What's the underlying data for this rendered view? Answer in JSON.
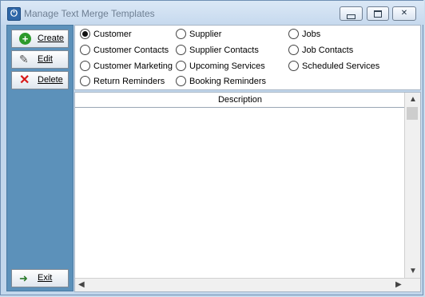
{
  "window": {
    "title": "Manage Text Merge Templates"
  },
  "sidebar": {
    "create": "Create",
    "edit": "Edit",
    "delete": "Delete",
    "exit": "Exit"
  },
  "radios": [
    {
      "label": "Customer",
      "selected": true
    },
    {
      "label": "Supplier",
      "selected": false
    },
    {
      "label": "Jobs",
      "selected": false
    },
    {
      "label": "Customer Contacts",
      "selected": false
    },
    {
      "label": "Supplier Contacts",
      "selected": false
    },
    {
      "label": "Job Contacts",
      "selected": false
    },
    {
      "label": "Customer Marketing",
      "selected": false
    },
    {
      "label": "Upcoming Services",
      "selected": false
    },
    {
      "label": "Scheduled Services",
      "selected": false
    },
    {
      "label": "Return Reminders",
      "selected": false
    },
    {
      "label": "Booking Reminders",
      "selected": false
    }
  ],
  "grid": {
    "column": "Description",
    "rows": []
  },
  "icons": [
    "app-icon",
    "minimize-icon",
    "maximize-icon",
    "close-icon",
    "create-icon",
    "edit-icon",
    "delete-icon",
    "exit-icon",
    "scroll-up-icon",
    "scroll-down-icon",
    "scroll-left-icon",
    "scroll-right-icon"
  ]
}
